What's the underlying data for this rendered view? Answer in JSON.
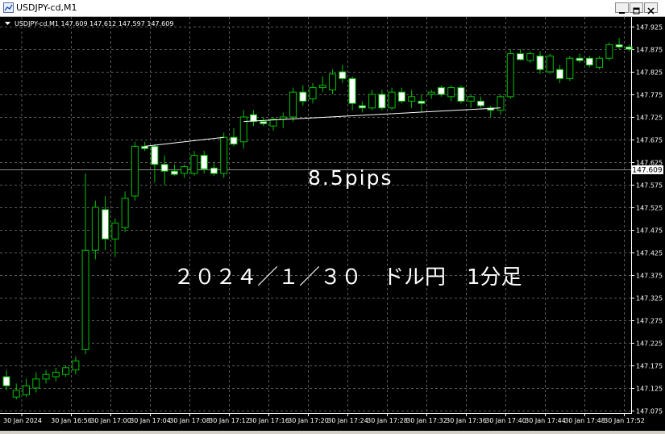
{
  "window": {
    "title": "USDJPY-cd,M1"
  },
  "chart_header": {
    "text": "USDJPY-cd,M1  147.609 147.612 147.597 147.609"
  },
  "annotations": {
    "pips": "8.5pips",
    "caption": "２０２４／１／３０　ドル円　1分足"
  },
  "colors": {
    "background": "#000000",
    "grid": "#5a5a5a",
    "bull": "#00c000",
    "bear_fill": "#ffffff",
    "current_line": "#8c8c8c",
    "trend_line": "#ffffff"
  },
  "icons": {
    "minimize": "minimize-icon",
    "maximize": "maximize-icon",
    "close": "close-icon",
    "app": "chart-app-icon"
  },
  "chart_data": {
    "type": "candlestick",
    "symbol": "USDJPY-cd",
    "timeframe": "M1",
    "ylim": [
      147.06,
      147.94
    ],
    "grid": true,
    "current_price": 147.609,
    "current_price_label": "147.609",
    "y_ticks": [
      "147.925",
      "147.875",
      "147.825",
      "147.775",
      "147.725",
      "147.675",
      "147.625",
      "147.575",
      "147.525",
      "147.475",
      "147.425",
      "147.375",
      "147.325",
      "147.275",
      "147.225",
      "147.175",
      "147.125",
      "147.075"
    ],
    "x_ticks": [
      "30 Jan 2024",
      "30 Jan 16:56",
      "30 Jan 17:00",
      "30 Jan 17:04",
      "30 Jan 17:08",
      "30 Jan 17:12",
      "30 Jan 17:16",
      "30 Jan 17:20",
      "30 Jan 17:24",
      "30 Jan 17:28",
      "30 Jan 17:32",
      "30 Jan 17:36",
      "30 Jan 17:40",
      "30 Jan 17:44",
      "30 Jan 17:48",
      "30 Jan 17:52"
    ],
    "candles": [
      {
        "t": "16:53",
        "o": 147.15,
        "h": 147.165,
        "l": 147.12,
        "c": 147.13
      },
      {
        "t": "16:54",
        "o": 147.105,
        "h": 147.135,
        "l": 147.1,
        "c": 147.12
      },
      {
        "t": "16:55",
        "o": 147.11,
        "h": 147.145,
        "l": 147.105,
        "c": 147.13
      },
      {
        "t": "16:56",
        "o": 147.125,
        "h": 147.16,
        "l": 147.115,
        "c": 147.145
      },
      {
        "t": "16:57",
        "o": 147.145,
        "h": 147.165,
        "l": 147.135,
        "c": 147.155
      },
      {
        "t": "16:58",
        "o": 147.15,
        "h": 147.17,
        "l": 147.14,
        "c": 147.16
      },
      {
        "t": "16:59",
        "o": 147.155,
        "h": 147.175,
        "l": 147.15,
        "c": 147.17
      },
      {
        "t": "17:00",
        "o": 147.165,
        "h": 147.195,
        "l": 147.155,
        "c": 147.185
      },
      {
        "t": "17:01",
        "o": 147.21,
        "h": 147.6,
        "l": 147.2,
        "c": 147.43
      },
      {
        "t": "17:02",
        "o": 147.43,
        "h": 147.54,
        "l": 147.41,
        "c": 147.525
      },
      {
        "t": "17:03",
        "o": 147.52,
        "h": 147.55,
        "l": 147.43,
        "c": 147.455
      },
      {
        "t": "17:04",
        "o": 147.455,
        "h": 147.5,
        "l": 147.415,
        "c": 147.49
      },
      {
        "t": "17:05",
        "o": 147.48,
        "h": 147.56,
        "l": 147.47,
        "c": 147.545
      },
      {
        "t": "17:06",
        "o": 147.55,
        "h": 147.67,
        "l": 147.54,
        "c": 147.66
      },
      {
        "t": "17:07",
        "o": 147.66,
        "h": 147.67,
        "l": 147.65,
        "c": 147.655
      },
      {
        "t": "17:08",
        "o": 147.66,
        "h": 147.665,
        "l": 147.58,
        "c": 147.62
      },
      {
        "t": "17:09",
        "o": 147.62,
        "h": 147.64,
        "l": 147.575,
        "c": 147.605
      },
      {
        "t": "17:10",
        "o": 147.605,
        "h": 147.62,
        "l": 147.595,
        "c": 147.598
      },
      {
        "t": "17:11",
        "o": 147.6,
        "h": 147.62,
        "l": 147.59,
        "c": 147.615
      },
      {
        "t": "17:12",
        "o": 147.6,
        "h": 147.65,
        "l": 147.595,
        "c": 147.64
      },
      {
        "t": "17:13",
        "o": 147.64,
        "h": 147.65,
        "l": 147.6,
        "c": 147.61
      },
      {
        "t": "17:14",
        "o": 147.612,
        "h": 147.625,
        "l": 147.595,
        "c": 147.6
      },
      {
        "t": "17:15",
        "o": 147.6,
        "h": 147.69,
        "l": 147.59,
        "c": 147.68
      },
      {
        "t": "17:16",
        "o": 147.68,
        "h": 147.7,
        "l": 147.66,
        "c": 147.665
      },
      {
        "t": "17:17",
        "o": 147.67,
        "h": 147.74,
        "l": 147.655,
        "c": 147.725
      },
      {
        "t": "17:18",
        "o": 147.73,
        "h": 147.74,
        "l": 147.705,
        "c": 147.715
      },
      {
        "t": "17:19",
        "o": 147.715,
        "h": 147.725,
        "l": 147.705,
        "c": 147.71
      },
      {
        "t": "17:20",
        "o": 147.705,
        "h": 147.725,
        "l": 147.695,
        "c": 147.72
      },
      {
        "t": "17:21",
        "o": 147.72,
        "h": 147.735,
        "l": 147.7,
        "c": 147.725
      },
      {
        "t": "17:22",
        "o": 147.725,
        "h": 147.79,
        "l": 147.715,
        "c": 147.78
      },
      {
        "t": "17:23",
        "o": 147.78,
        "h": 147.795,
        "l": 147.75,
        "c": 147.76
      },
      {
        "t": "17:24",
        "o": 147.765,
        "h": 147.8,
        "l": 147.755,
        "c": 147.79
      },
      {
        "t": "17:25",
        "o": 147.79,
        "h": 147.815,
        "l": 147.78,
        "c": 147.795
      },
      {
        "t": "17:26",
        "o": 147.785,
        "h": 147.83,
        "l": 147.775,
        "c": 147.82
      },
      {
        "t": "17:27",
        "o": 147.825,
        "h": 147.84,
        "l": 147.8,
        "c": 147.81
      },
      {
        "t": "17:28",
        "o": 147.81,
        "h": 147.815,
        "l": 147.74,
        "c": 147.755
      },
      {
        "t": "17:29",
        "o": 147.75,
        "h": 147.76,
        "l": 147.735,
        "c": 147.745
      },
      {
        "t": "17:30",
        "o": 147.745,
        "h": 147.785,
        "l": 147.74,
        "c": 147.775
      },
      {
        "t": "17:31",
        "o": 147.775,
        "h": 147.785,
        "l": 147.74,
        "c": 147.745
      },
      {
        "t": "17:32",
        "o": 147.745,
        "h": 147.79,
        "l": 147.74,
        "c": 147.78
      },
      {
        "t": "17:33",
        "o": 147.78,
        "h": 147.79,
        "l": 147.755,
        "c": 147.76
      },
      {
        "t": "17:34",
        "o": 147.76,
        "h": 147.785,
        "l": 147.745,
        "c": 147.77
      },
      {
        "t": "17:35",
        "o": 147.76,
        "h": 147.775,
        "l": 147.735,
        "c": 147.755
      },
      {
        "t": "17:36",
        "o": 147.775,
        "h": 147.785,
        "l": 147.765,
        "c": 147.78
      },
      {
        "t": "17:37",
        "o": 147.79,
        "h": 147.795,
        "l": 147.77,
        "c": 147.775
      },
      {
        "t": "17:38",
        "o": 147.77,
        "h": 147.795,
        "l": 147.76,
        "c": 147.79
      },
      {
        "t": "17:39",
        "o": 147.79,
        "h": 147.795,
        "l": 147.755,
        "c": 147.76
      },
      {
        "t": "17:40",
        "o": 147.76,
        "h": 147.775,
        "l": 147.745,
        "c": 147.77
      },
      {
        "t": "17:41",
        "o": 147.76,
        "h": 147.77,
        "l": 147.745,
        "c": 147.75
      },
      {
        "t": "17:42",
        "o": 147.745,
        "h": 147.75,
        "l": 147.725,
        "c": 147.74
      },
      {
        "t": "17:43",
        "o": 147.74,
        "h": 147.775,
        "l": 147.73,
        "c": 147.77
      },
      {
        "t": "17:44",
        "o": 147.77,
        "h": 147.875,
        "l": 147.765,
        "c": 147.865
      },
      {
        "t": "17:45",
        "o": 147.865,
        "h": 147.875,
        "l": 147.85,
        "c": 147.852
      },
      {
        "t": "17:46",
        "o": 147.85,
        "h": 147.87,
        "l": 147.845,
        "c": 147.865
      },
      {
        "t": "17:47",
        "o": 147.86,
        "h": 147.87,
        "l": 147.82,
        "c": 147.83
      },
      {
        "t": "17:48",
        "o": 147.825,
        "h": 147.865,
        "l": 147.82,
        "c": 147.86
      },
      {
        "t": "17:49",
        "o": 147.83,
        "h": 147.84,
        "l": 147.8,
        "c": 147.81
      },
      {
        "t": "17:50",
        "o": 147.81,
        "h": 147.86,
        "l": 147.805,
        "c": 147.855
      },
      {
        "t": "17:51",
        "o": 147.855,
        "h": 147.865,
        "l": 147.845,
        "c": 147.85
      },
      {
        "t": "17:52",
        "o": 147.855,
        "h": 147.86,
        "l": 147.835,
        "c": 147.84
      },
      {
        "t": "17:53",
        "o": 147.835,
        "h": 147.86,
        "l": 147.83,
        "c": 147.855
      },
      {
        "t": "17:54",
        "o": 147.855,
        "h": 147.89,
        "l": 147.85,
        "c": 147.885
      },
      {
        "t": "17:55",
        "o": 147.885,
        "h": 147.9,
        "l": 147.875,
        "c": 147.88
      },
      {
        "t": "17:56",
        "o": 147.88,
        "h": 147.885,
        "l": 147.87,
        "c": 147.875
      }
    ],
    "trendlines": [
      {
        "from": {
          "t": "17:07",
          "price": 147.66
        },
        "to": {
          "t": "17:15",
          "price": 147.68
        }
      },
      {
        "from": {
          "t": "17:17",
          "price": 147.715
        },
        "to": {
          "t": "17:43",
          "price": 147.745
        }
      }
    ]
  }
}
